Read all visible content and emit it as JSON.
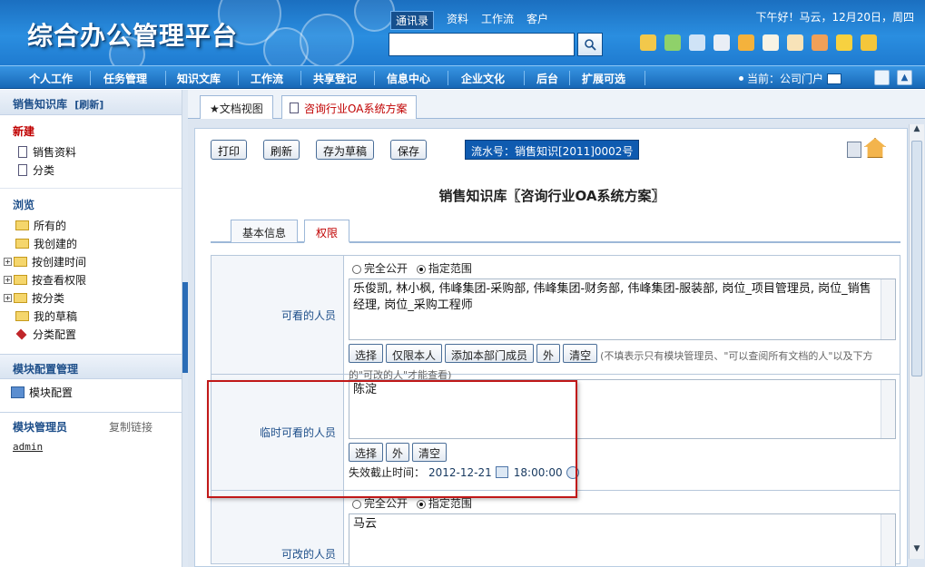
{
  "header": {
    "logo": "综合办公管理平台",
    "quick_tabs": [
      "通讯录",
      "资料",
      "工作流",
      "客户"
    ],
    "greeting": "下午好！马云，12月20日，周四"
  },
  "nav": {
    "items": [
      "个人工作",
      "任务管理",
      "知识文库",
      "工作流",
      "共享登记",
      "信息中心",
      "企业文化",
      "后台",
      "扩展可选"
    ],
    "current": "当前：公司门户"
  },
  "sidebar": {
    "title": "销售知识库",
    "refresh": "[刷新]",
    "new_label": "新建",
    "new_items": [
      "销售资料",
      "分类"
    ],
    "browse_label": "浏览",
    "browse_items": [
      "所有的",
      "我创建的",
      "按创建时间",
      "按查看权限",
      "按分类",
      "我的草稿",
      "分类配置"
    ],
    "module_config_label": "模块配置管理",
    "module_config_item": "模块配置",
    "admin_label": "模块管理员",
    "copy_link": "复制链接",
    "admin_user": "admin"
  },
  "tabs": {
    "doc_view": "★文档视图",
    "doc_tab": "咨询行业OA系统方案"
  },
  "toolbar": {
    "print": "打印",
    "refresh": "刷新",
    "save_draft": "存为草稿",
    "save": "保存",
    "serial": "流水号：销售知识[2011]0002号"
  },
  "doc_title": "销售知识库〖咨询行业OA系统方案〗",
  "subtabs": [
    "基本信息",
    "权限"
  ],
  "form": {
    "visible": {
      "label": "可看的人员",
      "option_public": "完全公开",
      "option_range": "指定范围",
      "value": "乐俊凯, 林小枫, 伟峰集团-采购部, 伟峰集团-财务部, 伟峰集团-服装部, 岗位_项目管理员, 岗位_销售经理, 岗位_采购工程师",
      "buttons": [
        "选择",
        "仅限本人",
        "添加本部门成员",
        "外",
        "清空"
      ],
      "hint": "(不填表示只有模块管理员、\"可以查阅所有文档的人\"以及下方的\"可改的人\"才能查看)"
    },
    "temp": {
      "label": "临时可看的人员",
      "value": "陈淀",
      "buttons": [
        "选择",
        "外",
        "清空"
      ],
      "expiry_label": "失效截止时间：",
      "expiry_date": "2012-12-21",
      "expiry_time": "18:00:00"
    },
    "editable": {
      "label": "可改的人员",
      "option_public": "完全公开",
      "option_range": "指定范围",
      "value": "马云"
    }
  }
}
